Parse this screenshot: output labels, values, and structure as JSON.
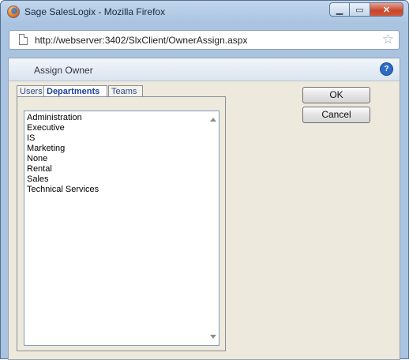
{
  "window": {
    "title": "Sage SalesLogix - Mozilla Firefox",
    "minimize": "▁",
    "maximize": "▭",
    "close": "✕"
  },
  "address": {
    "url": "http://webserver:3402/SlxClient/OwnerAssign.aspx"
  },
  "dialog": {
    "title": "Assign Owner",
    "tabs": [
      {
        "label": "Users",
        "active": false
      },
      {
        "label": "Departments",
        "active": true
      },
      {
        "label": "Teams",
        "active": false
      }
    ],
    "items": [
      "Administration",
      "Executive",
      "IS",
      "Marketing",
      "None",
      "Rental",
      "Sales",
      "Technical Services"
    ],
    "ok_label": "OK",
    "cancel_label": "Cancel"
  }
}
